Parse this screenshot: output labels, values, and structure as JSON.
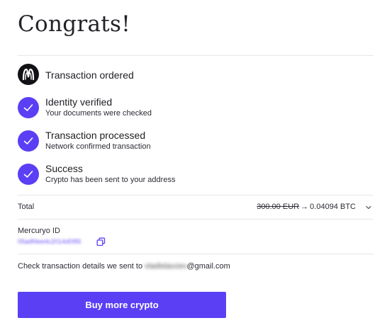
{
  "title": "Congrats!",
  "steps": [
    {
      "icon": "mercuryo-logo-icon",
      "title": "Transaction ordered",
      "subtitle": ""
    },
    {
      "icon": "check-icon",
      "title": "Identity verified",
      "subtitle": "Your documents were checked"
    },
    {
      "icon": "check-icon",
      "title": "Transaction processed",
      "subtitle": "Network confirmed transaction"
    },
    {
      "icon": "check-icon",
      "title": "Success",
      "subtitle": "Crypto has been sent to your address"
    }
  ],
  "total": {
    "label": "Total",
    "original_amount": "300.00 EUR",
    "arrow": "→",
    "crypto_amount": "0.04094 BTC",
    "icon": "chevron-down-icon"
  },
  "mercuryo": {
    "label": "Mercuryo ID",
    "id_value": "05adf4ee4c2014d095l",
    "copy_icon": "copy-icon"
  },
  "details": {
    "prefix": "Check transaction details we sent to ",
    "email_user": "vladislavzev",
    "email_domain": "@gmail.com"
  },
  "cta": {
    "label": "Buy more crypto"
  },
  "colors": {
    "accent": "#5a3ff5",
    "divider": "#e6e6ea",
    "text": "#1e1e24"
  }
}
